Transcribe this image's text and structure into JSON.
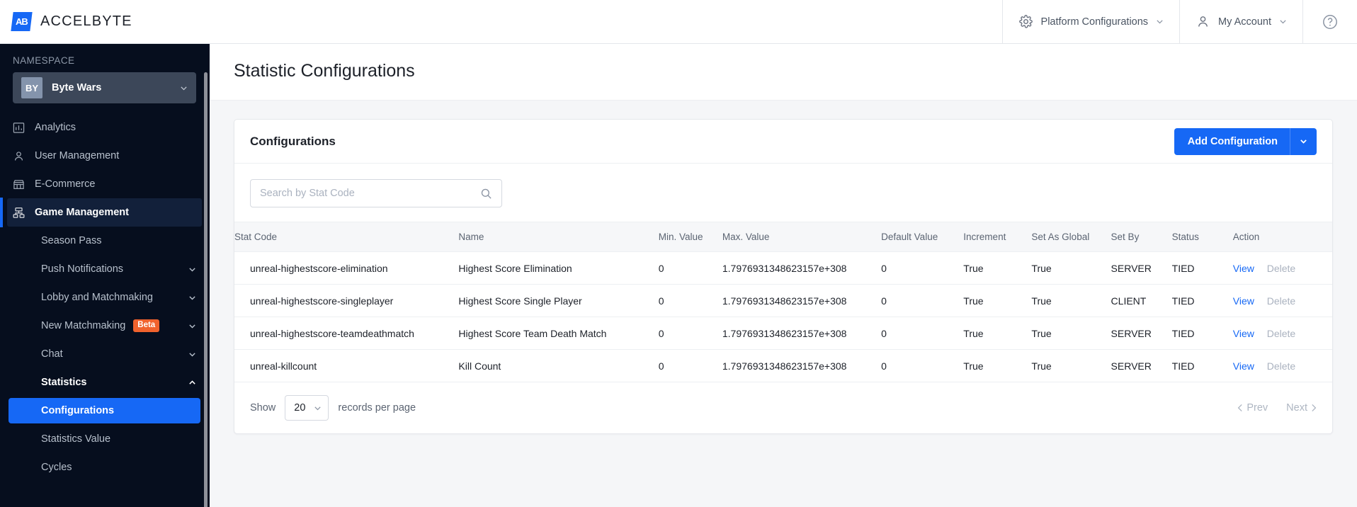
{
  "topbar": {
    "brand_mark": "AB",
    "brand_name": "ACCELBYTE",
    "platform_configurations": "Platform Configurations",
    "my_account": "My Account",
    "help": "?"
  },
  "sidebar": {
    "section_label": "NAMESPACE",
    "namespace": {
      "badge": "BY",
      "name": "Byte Wars"
    },
    "items": [
      {
        "label": "Analytics",
        "icon": "chart-bar-icon",
        "active": false
      },
      {
        "label": "User Management",
        "icon": "user-icon",
        "active": false
      },
      {
        "label": "E-Commerce",
        "icon": "store-icon",
        "active": false
      },
      {
        "label": "Game Management",
        "icon": "server-rack-icon",
        "active": true
      }
    ],
    "sub_items": [
      {
        "label": "Season Pass",
        "expandable": false,
        "expanded": false,
        "bold": false
      },
      {
        "label": "Push Notifications",
        "expandable": true,
        "expanded": false,
        "bold": false
      },
      {
        "label": "Lobby and Matchmaking",
        "expandable": true,
        "expanded": false,
        "bold": false
      },
      {
        "label": "New Matchmaking",
        "badge": "Beta",
        "expandable": true,
        "expanded": false,
        "bold": false
      },
      {
        "label": "Chat",
        "expandable": true,
        "expanded": false,
        "bold": false
      },
      {
        "label": "Statistics",
        "expandable": true,
        "expanded": true,
        "bold": true
      }
    ],
    "statistics_children": [
      {
        "label": "Configurations",
        "selected": true
      },
      {
        "label": "Statistics Value",
        "selected": false
      },
      {
        "label": "Cycles",
        "selected": false
      }
    ]
  },
  "page": {
    "title": "Statistic Configurations"
  },
  "card": {
    "title": "Configurations",
    "add_button_label": "Add Configuration",
    "search_placeholder": "Search by Stat Code",
    "search_value": "",
    "search_icon": "search-icon"
  },
  "table": {
    "columns": [
      "Stat Code",
      "Name",
      "Min. Value",
      "Max. Value",
      "Default Value",
      "Increment",
      "Set As Global",
      "Set By",
      "Status",
      "Action"
    ],
    "rows": [
      {
        "stat_code": "unreal-highestscore-elimination",
        "name": "Highest Score Elimination",
        "min_value": "0",
        "max_value": "1.7976931348623157e+308",
        "default_value": "0",
        "increment": "True",
        "set_as_global": "True",
        "set_by": "SERVER",
        "status": "TIED",
        "action_view": "View",
        "action_delete": "Delete"
      },
      {
        "stat_code": "unreal-highestscore-singleplayer",
        "name": "Highest Score Single Player",
        "min_value": "0",
        "max_value": "1.7976931348623157e+308",
        "default_value": "0",
        "increment": "True",
        "set_as_global": "True",
        "set_by": "CLIENT",
        "status": "TIED",
        "action_view": "View",
        "action_delete": "Delete"
      },
      {
        "stat_code": "unreal-highestscore-teamdeathmatch",
        "name": "Highest Score Team Death Match",
        "min_value": "0",
        "max_value": "1.7976931348623157e+308",
        "default_value": "0",
        "increment": "True",
        "set_as_global": "True",
        "set_by": "SERVER",
        "status": "TIED",
        "action_view": "View",
        "action_delete": "Delete"
      },
      {
        "stat_code": "unreal-killcount",
        "name": "Kill Count",
        "min_value": "0",
        "max_value": "1.7976931348623157e+308",
        "default_value": "0",
        "increment": "True",
        "set_as_global": "True",
        "set_by": "SERVER",
        "status": "TIED",
        "action_view": "View",
        "action_delete": "Delete"
      }
    ]
  },
  "footer": {
    "show_label": "Show",
    "records_per_page_value": "20",
    "records_per_page_label": "records per page",
    "prev_label": "Prev",
    "next_label": "Next"
  },
  "colors": {
    "accent": "#1668f5",
    "sidebar_bg": "#060e1e",
    "beta_badge": "#f0622d",
    "link": "#1668f5"
  }
}
